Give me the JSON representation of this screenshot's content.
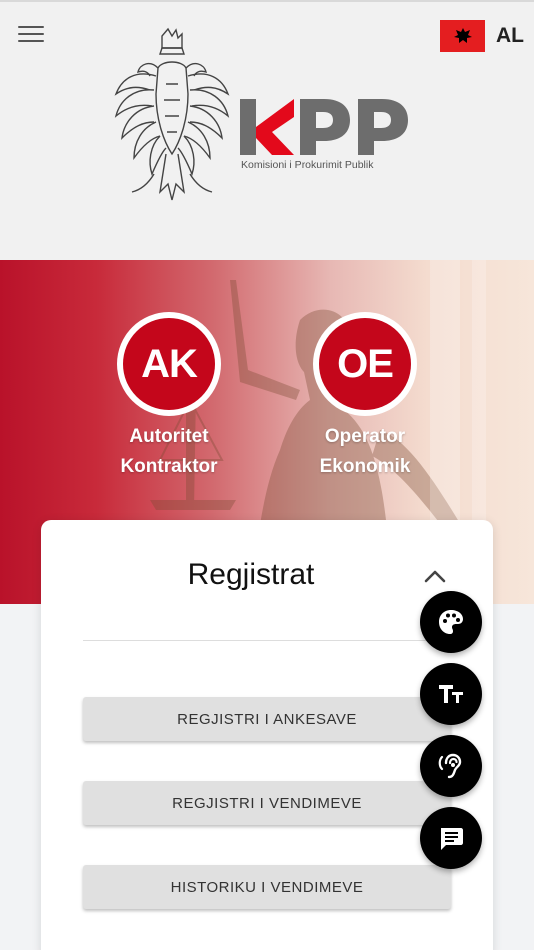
{
  "header": {
    "language_code": "AL",
    "icons": {
      "menu": "hamburger-menu-icon",
      "flag": "albania-flag-icon"
    }
  },
  "logo": {
    "wordmark": "KPP",
    "subtitle": "Komisioni i Prokurimit Publik",
    "emblem": "double-headed-eagle"
  },
  "hero": {
    "items": [
      {
        "abbr": "AK",
        "line1": "Autoritet",
        "line2": "Kontraktor"
      },
      {
        "abbr": "OE",
        "line1": "Operator",
        "line2": "Ekonomik"
      }
    ]
  },
  "registers": {
    "title": "Regjistrat",
    "buttons": [
      {
        "label": "REGJISTRI I ANKESAVE"
      },
      {
        "label": "REGJISTRI I VENDIMEVE"
      },
      {
        "label": "HISTORIKU I VENDIMEVE"
      }
    ]
  },
  "fabs": [
    "palette-icon",
    "text-size-icon",
    "hearing-icon",
    "chat-icon"
  ],
  "colors": {
    "brand_red": "#c4061b",
    "logo_gray": "#6d6d6d",
    "fab": "#000000"
  }
}
